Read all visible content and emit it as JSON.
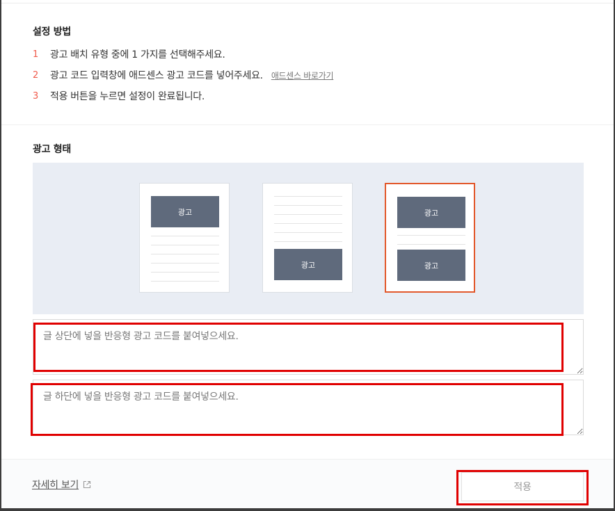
{
  "setup": {
    "title": "설정 방법",
    "steps": [
      {
        "num": "1",
        "text": "광고 배치 유형 중에 1 가지를 선택해주세요."
      },
      {
        "num": "2",
        "text": "광고 코드 입력창에 애드센스 광고 코드를 넣어주세요.",
        "link": "애드센스 바로가기"
      },
      {
        "num": "3",
        "text": "적용 버튼을 누르면 설정이 완료됩니다."
      }
    ]
  },
  "ad_type": {
    "title": "광고 형태",
    "ad_label": "광고",
    "selected_index": 2,
    "options": [
      "top",
      "bottom",
      "top-bottom"
    ]
  },
  "inputs": {
    "top_placeholder": "글 상단에 넣을 반응형 광고 코드를 붙여넣으세요.",
    "bottom_placeholder": "글 하단에 넣을 반응형 광고 코드를 붙여넣으세요."
  },
  "footer": {
    "more_label": "자세히 보기",
    "apply_label": "적용"
  },
  "colors": {
    "step_number": "#f05a4b",
    "ad_block": "#5f6a7c",
    "selected_border": "#e2582b",
    "preview_bg": "#e9edf4",
    "annotation_red": "#e00000"
  },
  "icons": {
    "external_link": "external-link-icon"
  }
}
